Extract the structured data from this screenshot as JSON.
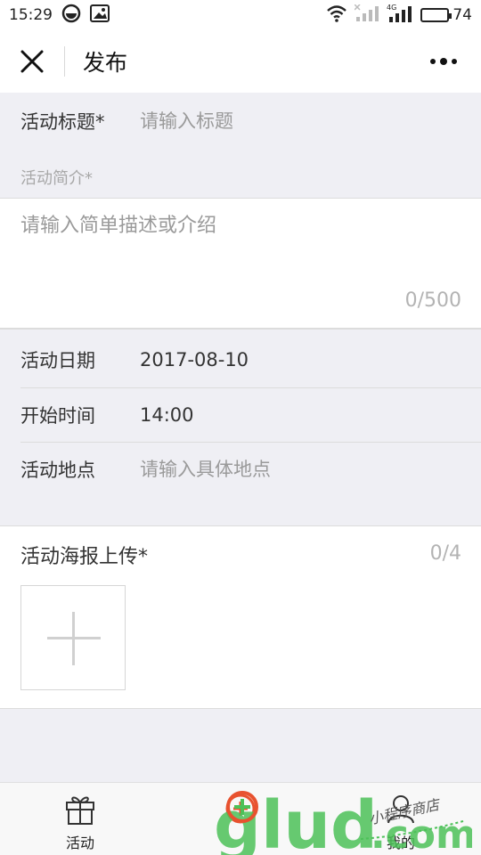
{
  "status_bar": {
    "time": "15:29",
    "network_label": "4G",
    "battery": "74",
    "battery_level": 0.74
  },
  "nav": {
    "title": "发布"
  },
  "form": {
    "title_label": "活动标题*",
    "title_placeholder": "请输入标题",
    "intro_label": "活动简介*",
    "intro_placeholder": "请输入简单描述或介绍",
    "intro_count": "0/500",
    "date_label": "活动日期",
    "date_value": "2017-08-10",
    "time_label": "开始时间",
    "time_value": "14:00",
    "place_label": "活动地点",
    "place_placeholder": "请输入具体地点",
    "poster_label": "活动海报上传*",
    "poster_count": "0/4"
  },
  "tabs": [
    {
      "label": "活动",
      "icon": "gift-icon"
    },
    {
      "label": "",
      "icon": "add-icon"
    },
    {
      "label": "我的",
      "icon": "user-icon"
    }
  ],
  "watermark": {
    "brand": "glud.com",
    "tagline": "小程序商店"
  },
  "colors": {
    "background": "#efeff4",
    "watermark_green": "#4cc158",
    "watermark_orange": "#e8522f"
  }
}
